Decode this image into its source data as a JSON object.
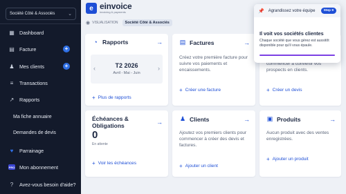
{
  "sidebar": {
    "company": "Société Côté & Associés",
    "items": [
      {
        "label": "Dashboard",
        "icon": "dashboard-icon"
      },
      {
        "label": "Facture",
        "icon": "invoice-icon"
      },
      {
        "label": "Mes clients",
        "icon": "clients-icon"
      },
      {
        "label": "Transactions",
        "icon": "transactions-icon"
      },
      {
        "label": "Rapports",
        "icon": "reports-icon"
      },
      {
        "label": "Ma fiche annuaire"
      },
      {
        "label": "Demandes de devis"
      },
      {
        "label": "Parrainage",
        "icon": "heart-icon"
      },
      {
        "label": "Mon abonnement",
        "icon": "pro-badge-icon",
        "badge": "PRO"
      },
      {
        "label": "Avez-vous besoin d'aide?",
        "icon": "help-icon"
      }
    ]
  },
  "logo": {
    "name": "einvoice",
    "tagline": "invoicing & payments"
  },
  "breadcrumb": {
    "mode": "VISUALISATION",
    "company": "Société Côté & Associés"
  },
  "cards": {
    "rapports": {
      "title": "Rapports",
      "quarter": "T2 2026",
      "months": "Avril - Mai - Juin",
      "link": "Plus de rapports"
    },
    "factures": {
      "title": "Factures",
      "text": "Créez votre première facture pour suivre vos paiements et encaissements.",
      "link": "Créer une facture"
    },
    "devis": {
      "text": "Créez votre premier devis pour commencer à convertir vos prospects en clients.",
      "link": "Créer un devis"
    },
    "echeances": {
      "title": "Échéances & Obligations",
      "count": "0",
      "note": "En attente",
      "link": "Voir les échéances"
    },
    "clients": {
      "title": "Clients",
      "text": "Ajoutez vos premiers clients pour commencer à créer des devis et factures.",
      "link": "Ajouter un client"
    },
    "produits": {
      "title": "Produits",
      "text": "Aucun produit avec des ventes enregistrées.",
      "link": "Ajouter un produit"
    }
  },
  "popup": {
    "header": "Agrandissez votre équipe",
    "step": "Step 9",
    "title": "Il voit vos sociétés clientes",
    "text": "Chaque société que vous gérez est aussitôt disponible pour qu'il vous épaule."
  },
  "colors": {
    "sidebar": "#131a2b",
    "accent": "#1e4fd6",
    "plus": "#2f6fe4",
    "progress": "#7b3fe4",
    "pin": "#e23b4e"
  }
}
